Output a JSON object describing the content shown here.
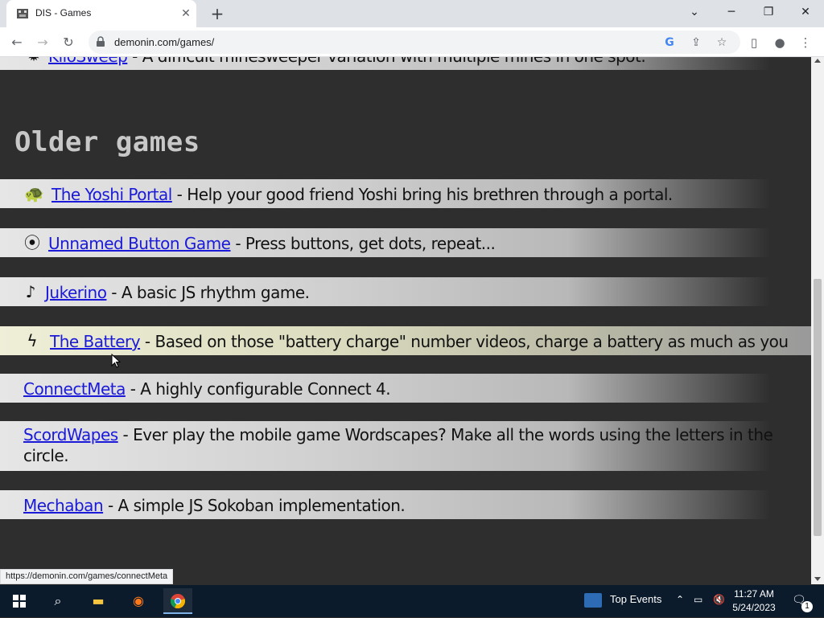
{
  "browser": {
    "tab_title": "DIS - Games",
    "tab_close": "✕",
    "new_tab": "+",
    "url": "demonin.com/games/",
    "status_url": "https://demonin.com/games/connectMeta"
  },
  "page": {
    "top_partial_link": "KiloSweep",
    "top_partial_desc": " - A difficult minesweeper variation with multiple mines in one spot.",
    "heading": "Older games",
    "games": [
      {
        "icon": "yoshi-icon",
        "glyph": "🐢",
        "link": "The Yoshi Portal",
        "desc": " - Help your good friend Yoshi bring his brethren through a portal."
      },
      {
        "icon": "dot-button-icon",
        "glyph": "⦿",
        "link": "Unnamed Button Game",
        "desc": " - Press buttons, get dots, repeat..."
      },
      {
        "icon": "music-note-icon",
        "glyph": "♪",
        "link": "Jukerino",
        "desc": " - A basic JS rhythm game."
      },
      {
        "icon": "lightning-icon",
        "glyph": "ϟ",
        "link": "The Battery",
        "desc": " - Based on those \"battery charge\" number videos, charge a battery as much as you"
      },
      {
        "icon": "",
        "glyph": "",
        "link": "ConnectMeta",
        "desc": " - A highly configurable Connect 4."
      },
      {
        "icon": "",
        "glyph": "",
        "link": "ScordWapes",
        "desc": " - Ever play the mobile game Wordscapes? Make all the words using the letters in the circle."
      },
      {
        "icon": "",
        "glyph": "",
        "link": "Mechaban",
        "desc": " - A simple JS Sokoban implementation."
      }
    ]
  },
  "taskbar": {
    "weather_label": "Top Events",
    "time": "11:27 AM",
    "date": "5/24/2023",
    "notification_count": "1"
  },
  "colors": {
    "link": "#1a1ad8",
    "background": "#2e2e2e",
    "heading": "#c8c8c8"
  }
}
